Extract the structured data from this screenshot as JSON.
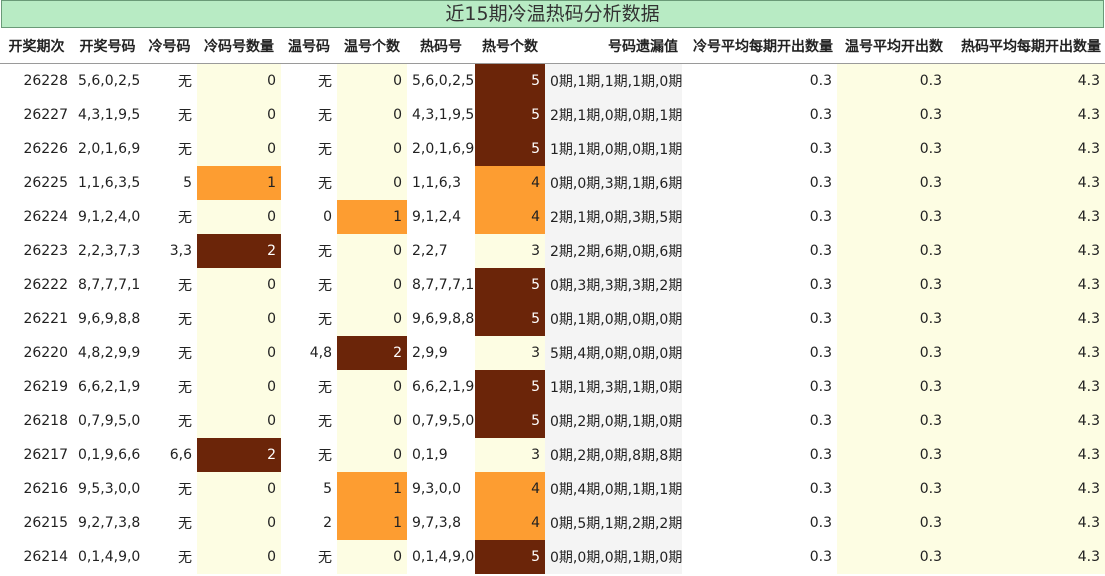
{
  "title": "近15期冷温热码分析数据",
  "headers": [
    "开奖期次",
    "开奖号码",
    "冷号码",
    "冷码号数量",
    "温号码",
    "温号个数",
    "热码号",
    "热号个数",
    "号码遗漏值",
    "冷号平均每期开出数量",
    "温号平均开出数",
    "热码平均每期开出数量"
  ],
  "colors": {
    "orange": "#fd9d31",
    "brown": "#6b2509",
    "cream": "#fdfde3",
    "header_green": "#b8ebc4"
  },
  "rows": [
    {
      "issue": "26228",
      "numbers": "5,6,0,2,5",
      "cold": "无",
      "cold_count": "0",
      "warm": "无",
      "warm_count": "0",
      "hot": "5,6,0,2,5",
      "hot_count": "5",
      "missing": "0期,1期,1期,1期,0期",
      "cold_avg": "0.3",
      "warm_avg": "0.3",
      "hot_avg": "4.3"
    },
    {
      "issue": "26227",
      "numbers": "4,3,1,9,5",
      "cold": "无",
      "cold_count": "0",
      "warm": "无",
      "warm_count": "0",
      "hot": "4,3,1,9,5",
      "hot_count": "5",
      "missing": "2期,1期,0期,0期,1期",
      "cold_avg": "0.3",
      "warm_avg": "0.3",
      "hot_avg": "4.3"
    },
    {
      "issue": "26226",
      "numbers": "2,0,1,6,9",
      "cold": "无",
      "cold_count": "0",
      "warm": "无",
      "warm_count": "0",
      "hot": "2,0,1,6,9",
      "hot_count": "5",
      "missing": "1期,1期,0期,0期,1期",
      "cold_avg": "0.3",
      "warm_avg": "0.3",
      "hot_avg": "4.3"
    },
    {
      "issue": "26225",
      "numbers": "1,1,6,3,5",
      "cold": "5",
      "cold_count": "1",
      "warm": "无",
      "warm_count": "0",
      "hot": "1,1,6,3",
      "hot_count": "4",
      "missing": "0期,0期,3期,1期,6期",
      "cold_avg": "0.3",
      "warm_avg": "0.3",
      "hot_avg": "4.3"
    },
    {
      "issue": "26224",
      "numbers": "9,1,2,4,0",
      "cold": "无",
      "cold_count": "0",
      "warm": "0",
      "warm_count": "1",
      "hot": "9,1,2,4",
      "hot_count": "4",
      "missing": "2期,1期,0期,3期,5期",
      "cold_avg": "0.3",
      "warm_avg": "0.3",
      "hot_avg": "4.3"
    },
    {
      "issue": "26223",
      "numbers": "2,2,3,7,3",
      "cold": "3,3",
      "cold_count": "2",
      "warm": "无",
      "warm_count": "0",
      "hot": "2,2,7",
      "hot_count": "3",
      "missing": "2期,2期,6期,0期,6期",
      "cold_avg": "0.3",
      "warm_avg": "0.3",
      "hot_avg": "4.3"
    },
    {
      "issue": "26222",
      "numbers": "8,7,7,7,1",
      "cold": "无",
      "cold_count": "0",
      "warm": "无",
      "warm_count": "0",
      "hot": "8,7,7,7,1",
      "hot_count": "5",
      "missing": "0期,3期,3期,3期,2期",
      "cold_avg": "0.3",
      "warm_avg": "0.3",
      "hot_avg": "4.3"
    },
    {
      "issue": "26221",
      "numbers": "9,6,9,8,8",
      "cold": "无",
      "cold_count": "0",
      "warm": "无",
      "warm_count": "0",
      "hot": "9,6,9,8,8",
      "hot_count": "5",
      "missing": "0期,1期,0期,0期,0期",
      "cold_avg": "0.3",
      "warm_avg": "0.3",
      "hot_avg": "4.3"
    },
    {
      "issue": "26220",
      "numbers": "4,8,2,9,9",
      "cold": "无",
      "cold_count": "0",
      "warm": "4,8",
      "warm_count": "2",
      "hot": "2,9,9",
      "hot_count": "3",
      "missing": "5期,4期,0期,0期,0期",
      "cold_avg": "0.3",
      "warm_avg": "0.3",
      "hot_avg": "4.3"
    },
    {
      "issue": "26219",
      "numbers": "6,6,2,1,9",
      "cold": "无",
      "cold_count": "0",
      "warm": "无",
      "warm_count": "0",
      "hot": "6,6,2,1,9",
      "hot_count": "5",
      "missing": "1期,1期,3期,1期,0期",
      "cold_avg": "0.3",
      "warm_avg": "0.3",
      "hot_avg": "4.3"
    },
    {
      "issue": "26218",
      "numbers": "0,7,9,5,0",
      "cold": "无",
      "cold_count": "0",
      "warm": "无",
      "warm_count": "0",
      "hot": "0,7,9,5,0",
      "hot_count": "5",
      "missing": "0期,2期,0期,1期,0期",
      "cold_avg": "0.3",
      "warm_avg": "0.3",
      "hot_avg": "4.3"
    },
    {
      "issue": "26217",
      "numbers": "0,1,9,6,6",
      "cold": "6,6",
      "cold_count": "2",
      "warm": "无",
      "warm_count": "0",
      "hot": "0,1,9",
      "hot_count": "3",
      "missing": "0期,2期,0期,8期,8期",
      "cold_avg": "0.3",
      "warm_avg": "0.3",
      "hot_avg": "4.3"
    },
    {
      "issue": "26216",
      "numbers": "9,5,3,0,0",
      "cold": "无",
      "cold_count": "0",
      "warm": "5",
      "warm_count": "1",
      "hot": "9,3,0,0",
      "hot_count": "4",
      "missing": "0期,4期,0期,1期,1期",
      "cold_avg": "0.3",
      "warm_avg": "0.3",
      "hot_avg": "4.3"
    },
    {
      "issue": "26215",
      "numbers": "9,2,7,3,8",
      "cold": "无",
      "cold_count": "0",
      "warm": "2",
      "warm_count": "1",
      "hot": "9,7,3,8",
      "hot_count": "4",
      "missing": "0期,5期,1期,2期,2期",
      "cold_avg": "0.3",
      "warm_avg": "0.3",
      "hot_avg": "4.3"
    },
    {
      "issue": "26214",
      "numbers": "0,1,4,9,0",
      "cold": "无",
      "cold_count": "0",
      "warm": "无",
      "warm_count": "0",
      "hot": "0,1,4,9,0",
      "hot_count": "5",
      "missing": "0期,0期,0期,1期,0期",
      "cold_avg": "0.3",
      "warm_avg": "0.3",
      "hot_avg": "4.3"
    }
  ]
}
